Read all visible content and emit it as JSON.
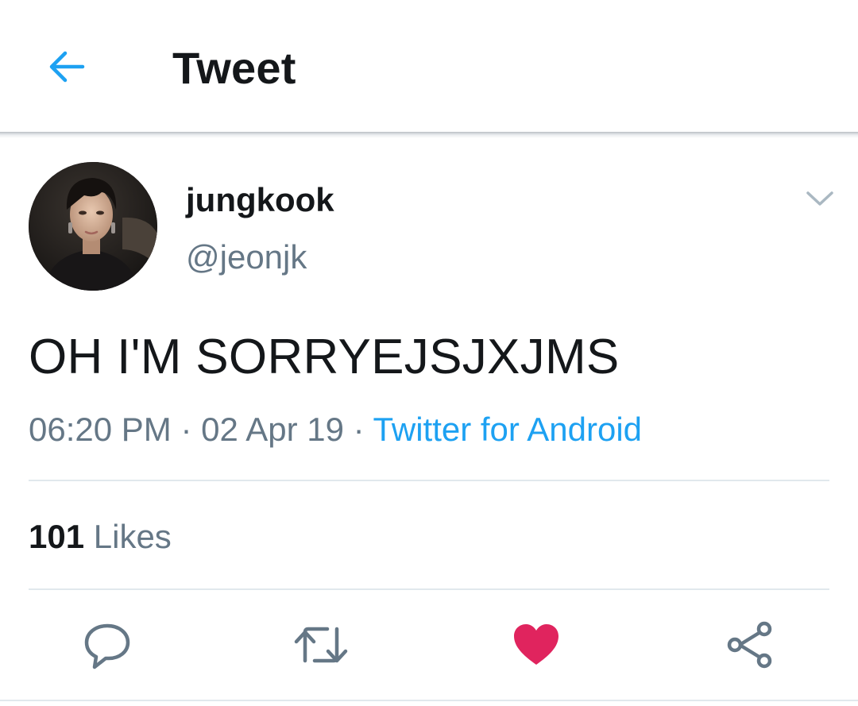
{
  "header": {
    "title": "Tweet",
    "back_icon": "arrow-left-icon",
    "accent_color": "#1da1f2"
  },
  "tweet": {
    "author": {
      "display_name": "jungkook",
      "handle": "@jeonjk",
      "avatar": "avatar-photo"
    },
    "more_icon": "chevron-down-icon",
    "text": "OH I'M SORRYEJSJXJMS",
    "time": "06:20 PM",
    "separator": "·",
    "date": "02 Apr 19",
    "source": "Twitter for Android",
    "likes": {
      "count": "101",
      "label": "Likes"
    }
  },
  "actions": {
    "reply": "reply-icon",
    "retweet": "retweet-icon",
    "like": "heart-icon",
    "like_color": "#e0245e",
    "share": "share-icon"
  },
  "colors": {
    "text_primary": "#14171a",
    "text_secondary": "#657786",
    "divider": "#e1e8ed"
  }
}
